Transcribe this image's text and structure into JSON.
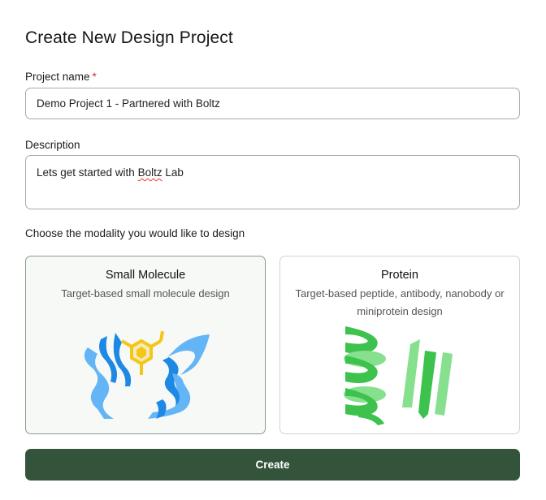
{
  "dialog": {
    "title": "Create New Design Project"
  },
  "form": {
    "project_name_label": "Project name",
    "required_marker": "*",
    "project_name_value": "Demo Project 1 - Partnered with Boltz",
    "description_label": "Description",
    "description_value_prefix": "Lets get started with ",
    "description_value_misspelled": "Boltz",
    "description_value_suffix": " Lab",
    "modality_prompt": "Choose the modality you would like to design"
  },
  "modalities": [
    {
      "title": "Small Molecule",
      "description": "Target-based small molecule design",
      "selected": true,
      "illustration": "small-molecule-illustration"
    },
    {
      "title": "Protein",
      "description": "Target-based peptide, antibody, nanobody or miniprotein design",
      "selected": false,
      "illustration": "protein-illustration"
    }
  ],
  "actions": {
    "create_label": "Create"
  },
  "colors": {
    "primary_button": "#33543a",
    "required": "#d32f2f",
    "selected_card_bg": "#f6f9f6",
    "molecule_blue_light": "#64b5f6",
    "molecule_blue_dark": "#1e88e5",
    "molecule_yellow": "#f5c518",
    "protein_green_light": "#86e08e",
    "protein_green_dark": "#3cc24d"
  }
}
